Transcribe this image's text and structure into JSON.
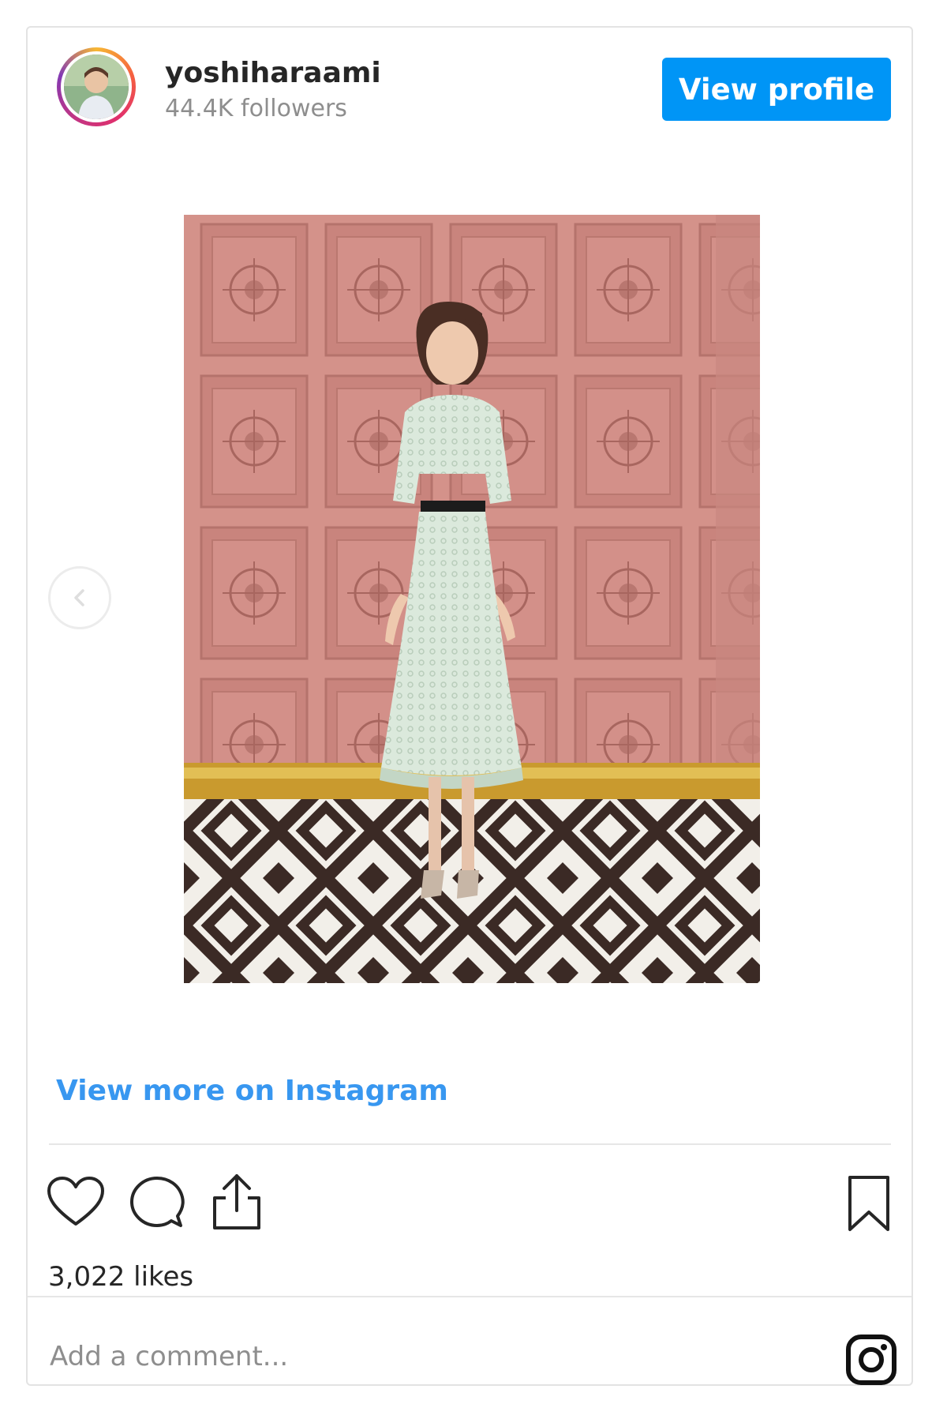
{
  "header": {
    "username": "yoshiharaami",
    "followers": "44.4K followers",
    "view_profile_label": "View profile"
  },
  "post": {
    "view_more_label": "View more on Instagram",
    "likes": "3,022 likes",
    "comment_placeholder": "Add a comment..."
  },
  "colors": {
    "accent": "#0095f6",
    "link": "#3897f0",
    "wall": "#d7948a",
    "dress": "#d9e8da"
  },
  "icons": [
    "heart-icon",
    "comment-icon",
    "share-icon",
    "bookmark-icon",
    "instagram-icon",
    "chevron-left-icon"
  ]
}
